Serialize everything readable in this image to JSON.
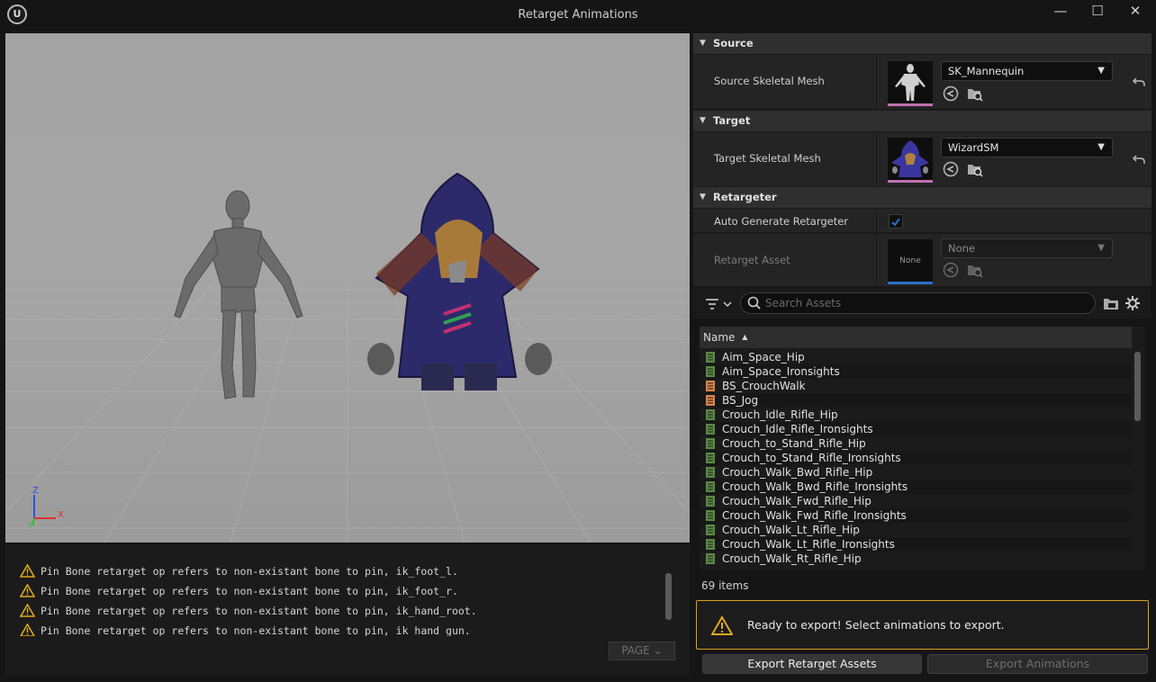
{
  "window": {
    "logo_text": "U",
    "title": "Retarget Animations",
    "minimize": "—",
    "maximize": "☐",
    "close": "✕"
  },
  "viewport": {
    "axis": {
      "z": "Z",
      "y": "Y",
      "x": "X"
    }
  },
  "log": {
    "lines": [
      "Pin Bone retarget op refers to non-existant bone to pin, ik_foot_l.",
      "Pin Bone retarget op refers to non-existant bone to pin, ik_foot_r.",
      "Pin Bone retarget op refers to non-existant bone to pin, ik_hand_root.",
      "Pin Bone retarget op refers to non-existant bone to pin, ik_hand_gun."
    ],
    "page_button": "PAGE"
  },
  "details": {
    "source": {
      "category": "Source",
      "label": "Source Skeletal Mesh",
      "value": "SK_Mannequin"
    },
    "target": {
      "category": "Target",
      "label": "Target Skeletal Mesh",
      "value": "WizardSM"
    },
    "retargeter": {
      "category": "Retargeter",
      "auto_label": "Auto Generate Retargeter",
      "auto_checked": true,
      "asset_label": "Retarget Asset",
      "asset_thumb": "None",
      "asset_value": "None"
    }
  },
  "assets": {
    "search_placeholder": "Search Assets",
    "column_name": "Name",
    "sort_indicator": "▲",
    "items": [
      {
        "name": "Aim_Space_Hip",
        "kind": "anim"
      },
      {
        "name": "Aim_Space_Ironsights",
        "kind": "anim"
      },
      {
        "name": "BS_CrouchWalk",
        "kind": "blendspace"
      },
      {
        "name": "BS_Jog",
        "kind": "blendspace"
      },
      {
        "name": "Crouch_Idle_Rifle_Hip",
        "kind": "anim"
      },
      {
        "name": "Crouch_Idle_Rifle_Ironsights",
        "kind": "anim"
      },
      {
        "name": "Crouch_to_Stand_Rifle_Hip",
        "kind": "anim"
      },
      {
        "name": "Crouch_to_Stand_Rifle_Ironsights",
        "kind": "anim"
      },
      {
        "name": "Crouch_Walk_Bwd_Rifle_Hip",
        "kind": "anim"
      },
      {
        "name": "Crouch_Walk_Bwd_Rifle_Ironsights",
        "kind": "anim"
      },
      {
        "name": "Crouch_Walk_Fwd_Rifle_Hip",
        "kind": "anim"
      },
      {
        "name": "Crouch_Walk_Fwd_Rifle_Ironsights",
        "kind": "anim"
      },
      {
        "name": "Crouch_Walk_Lt_Rifle_Hip",
        "kind": "anim"
      },
      {
        "name": "Crouch_Walk_Lt_Rifle_Ironsights",
        "kind": "anim"
      },
      {
        "name": "Crouch_Walk_Rt_Rifle_Hip",
        "kind": "anim"
      }
    ],
    "count_label": "69 items"
  },
  "notice": {
    "text": "Ready to export! Select animations to export."
  },
  "buttons": {
    "export_assets": "Export Retarget Assets",
    "export_animations": "Export Animations"
  },
  "colors": {
    "accent_blue": "#2a6fc9",
    "warning": "#d9a31f",
    "anim_icon": "#5a8a45",
    "blendspace_icon": "#d9824a",
    "thumb_underline": "#c070b0"
  }
}
